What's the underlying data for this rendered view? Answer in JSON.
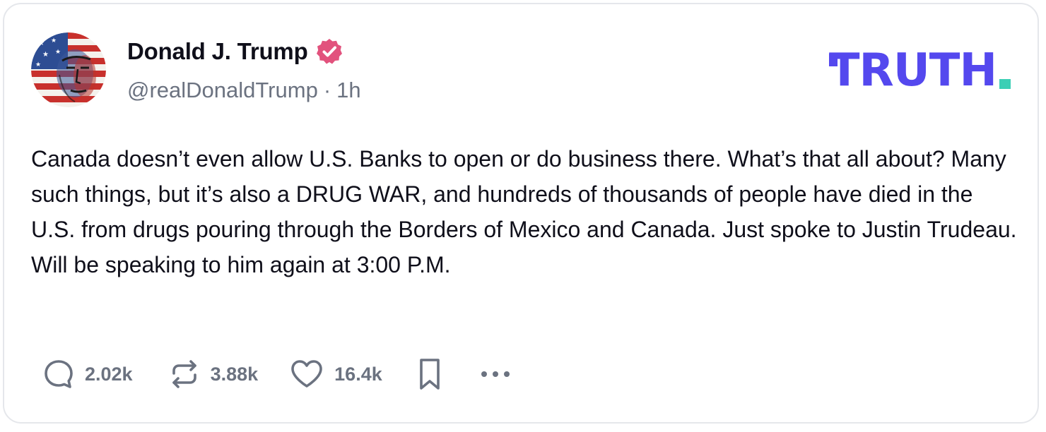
{
  "post": {
    "display_name": "Donald J. Trump",
    "handle": "@realDonaldTrump",
    "separator": "·",
    "time_ago": "1h",
    "body": "Canada doesn’t even allow U.S. Banks to open or do business there. What’s that all about? Many such things, but it’s also a DRUG WAR, and hundreds of thousands of people have died in the U.S. from drugs pouring through the Borders of Mexico and Canada. Just spoke to Justin Trudeau. Will be speaking to him again at 3:00 P.M.",
    "verified_icon": "verified-badge-icon",
    "avatar_icon": "flag-portrait-avatar"
  },
  "brand": {
    "logo_text": "TRUTH",
    "logo_color": "#5448ee",
    "logo_dot_color": "#3ccfb5"
  },
  "actions": {
    "replies": {
      "icon": "reply-icon",
      "count": "2.02k"
    },
    "retruths": {
      "icon": "retruth-icon",
      "count": "3.88k"
    },
    "likes": {
      "icon": "heart-icon",
      "count": "16.4k"
    },
    "bookmark": {
      "icon": "bookmark-icon"
    },
    "more": {
      "icon": "more-dots-icon"
    }
  },
  "colors": {
    "text_primary": "#0f0f1a",
    "text_secondary": "#6b7280",
    "verified_badge": "#e2527d",
    "card_border": "#e5e7eb"
  }
}
